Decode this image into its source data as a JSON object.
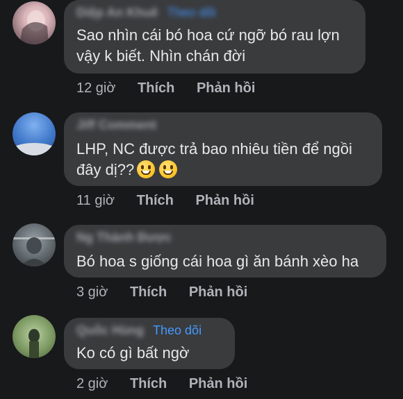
{
  "comments": [
    {
      "author": "Diệp An Khuê",
      "follow": "Theo dõi",
      "text_lines": [
        "Sao nhìn cái bó hoa cứ ngỡ bó rau lợn",
        "vậy k biết. Nhìn chán đời"
      ],
      "time": "12 giờ",
      "like": "Thích",
      "reply": "Phản hồi"
    },
    {
      "author": "Jiff Comment",
      "text_lines": [
        "LHP, NC được trả bao nhiêu tiền để ngồi",
        "đây dị??"
      ],
      "emojis": [
        "grinning-face",
        "grinning-face"
      ],
      "time": "11 giờ",
      "like": "Thích",
      "reply": "Phản hồi"
    },
    {
      "author": "Ng Thành Được",
      "text_lines": [
        "Bó hoa s giống cái hoa gì ăn bánh xèo ha"
      ],
      "time": "3 giờ",
      "like": "Thích",
      "reply": "Phản hồi"
    },
    {
      "author": "Quốc Hùng",
      "follow": "Theo dõi",
      "text_lines": [
        "Ko có gì bất ngờ"
      ],
      "time": "2 giờ",
      "like": "Thích",
      "reply": "Phản hồi"
    }
  ],
  "colors": {
    "background": "#18191b",
    "bubble": "#3a3b3d",
    "link": "#4599ff",
    "meta_text": "#b0b3b8"
  }
}
